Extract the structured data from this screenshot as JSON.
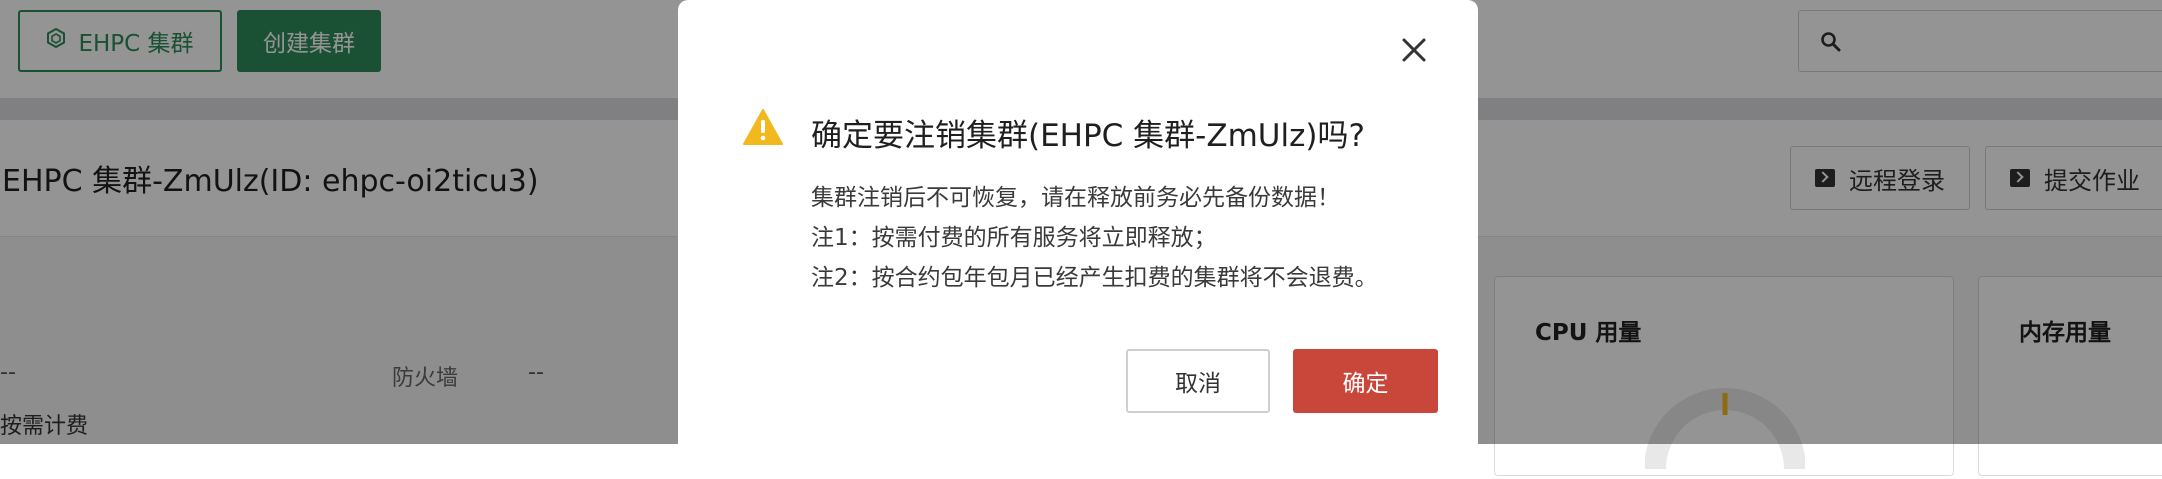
{
  "toolbar": {
    "cluster_button": "EHPC 集群",
    "create_button": "创建集群"
  },
  "header": {
    "title": "EHPC 集群-ZmUlz(ID: ehpc-oi2ticu3)",
    "remote_login": "远程登录",
    "submit_job": "提交作业"
  },
  "info": {
    "dash1": "--",
    "firewall_label": "防火墙",
    "dash2": "--",
    "billing": "按需计费"
  },
  "cards": {
    "cpu_title": "CPU 用量",
    "memory_title": "内存用量"
  },
  "dialog": {
    "title": "确定要注销集群(EHPC 集群-ZmUlz)吗?",
    "line1": "集群注销后不可恢复，请在释放前务必先备份数据！",
    "line2": "注1：按需付费的所有服务将立即释放；",
    "line3": "注2：按合约包年包月已经产生扣费的集群将不会退费。",
    "cancel": "取消",
    "confirm": "确定"
  },
  "icons": {
    "warning": "warning-icon",
    "close": "close-icon",
    "search": "search-icon",
    "cluster": "cluster-icon",
    "terminal": "terminal-icon"
  },
  "colors": {
    "primary_green": "#2e8a5b",
    "danger_red": "#c9473a",
    "warning_yellow": "#f2b91f"
  }
}
